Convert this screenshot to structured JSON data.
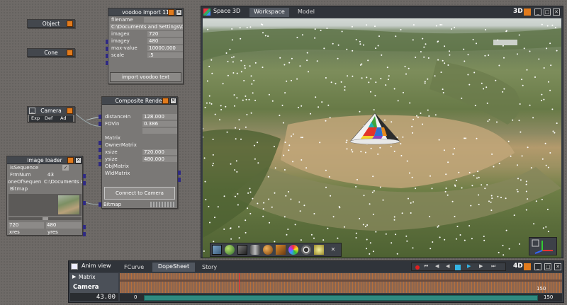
{
  "nodes": {
    "object": {
      "title": "Object"
    },
    "cone": {
      "title": "Cone"
    },
    "camera": {
      "title": "Camera",
      "tabs": [
        "Exp",
        "Def",
        "Ad"
      ]
    },
    "voodoo": {
      "title": "voodoo import 11",
      "rows": [
        {
          "label": "filename",
          "value": ""
        },
        {
          "label": "",
          "value": "C:\\Documents and Settings\\Cli"
        },
        {
          "label": "imagex",
          "value": "720"
        },
        {
          "label": "imagey",
          "value": "480"
        },
        {
          "label": "max-value",
          "value": "10000.000"
        },
        {
          "label": "scale",
          "value": ".5"
        }
      ],
      "button": "import voodoo text"
    },
    "composite": {
      "title": "Composite Render",
      "rows": [
        {
          "label": "distanceIn",
          "value": "128.000"
        },
        {
          "label": "FOVin",
          "value": "0.386"
        },
        {
          "label": "",
          "value": ""
        },
        {
          "label": "Matrix",
          "value": ""
        },
        {
          "label": "OwnerMatrix",
          "value": ""
        },
        {
          "label": "xsize",
          "value": "720.000"
        },
        {
          "label": "ysize",
          "value": "480.000"
        },
        {
          "label": "ObjMatrix",
          "value": ""
        },
        {
          "label": "WldMatrix",
          "value": ""
        }
      ],
      "button": "Connect to Camera",
      "output": "Bitmap"
    },
    "image_loader": {
      "title": "image loader",
      "rows": [
        {
          "label": "isSequence",
          "value": "✓"
        },
        {
          "label": "FrmNum",
          "value": "43"
        },
        {
          "label": "oneOfSequen",
          "value": "C:\\Documents an"
        },
        {
          "label": "Bitmap",
          "value": ""
        }
      ],
      "xres_value": "720",
      "yres_value": "480",
      "xres_label": "xres",
      "yres_label": "yres"
    }
  },
  "viewport": {
    "title": "Space 3D",
    "tabs": [
      "Workspace",
      "Model"
    ],
    "active_tab": "Workspace",
    "mode": "3D"
  },
  "anim": {
    "title": "Anim view",
    "tabs": [
      "FCurve",
      "DopeSheet",
      "Story"
    ],
    "active_tab": "DopeSheet",
    "mode": "4D",
    "track_matrix": "Matrix",
    "track_camera": "Camera",
    "frame": "43.00",
    "range_start": "0",
    "range_end": "150",
    "ruler_end": "150"
  },
  "colors": {
    "accent": "#e17b1d",
    "panel": "#3a3f46",
    "node": "#7a7876",
    "timeline_bar": "#2f8a80"
  }
}
